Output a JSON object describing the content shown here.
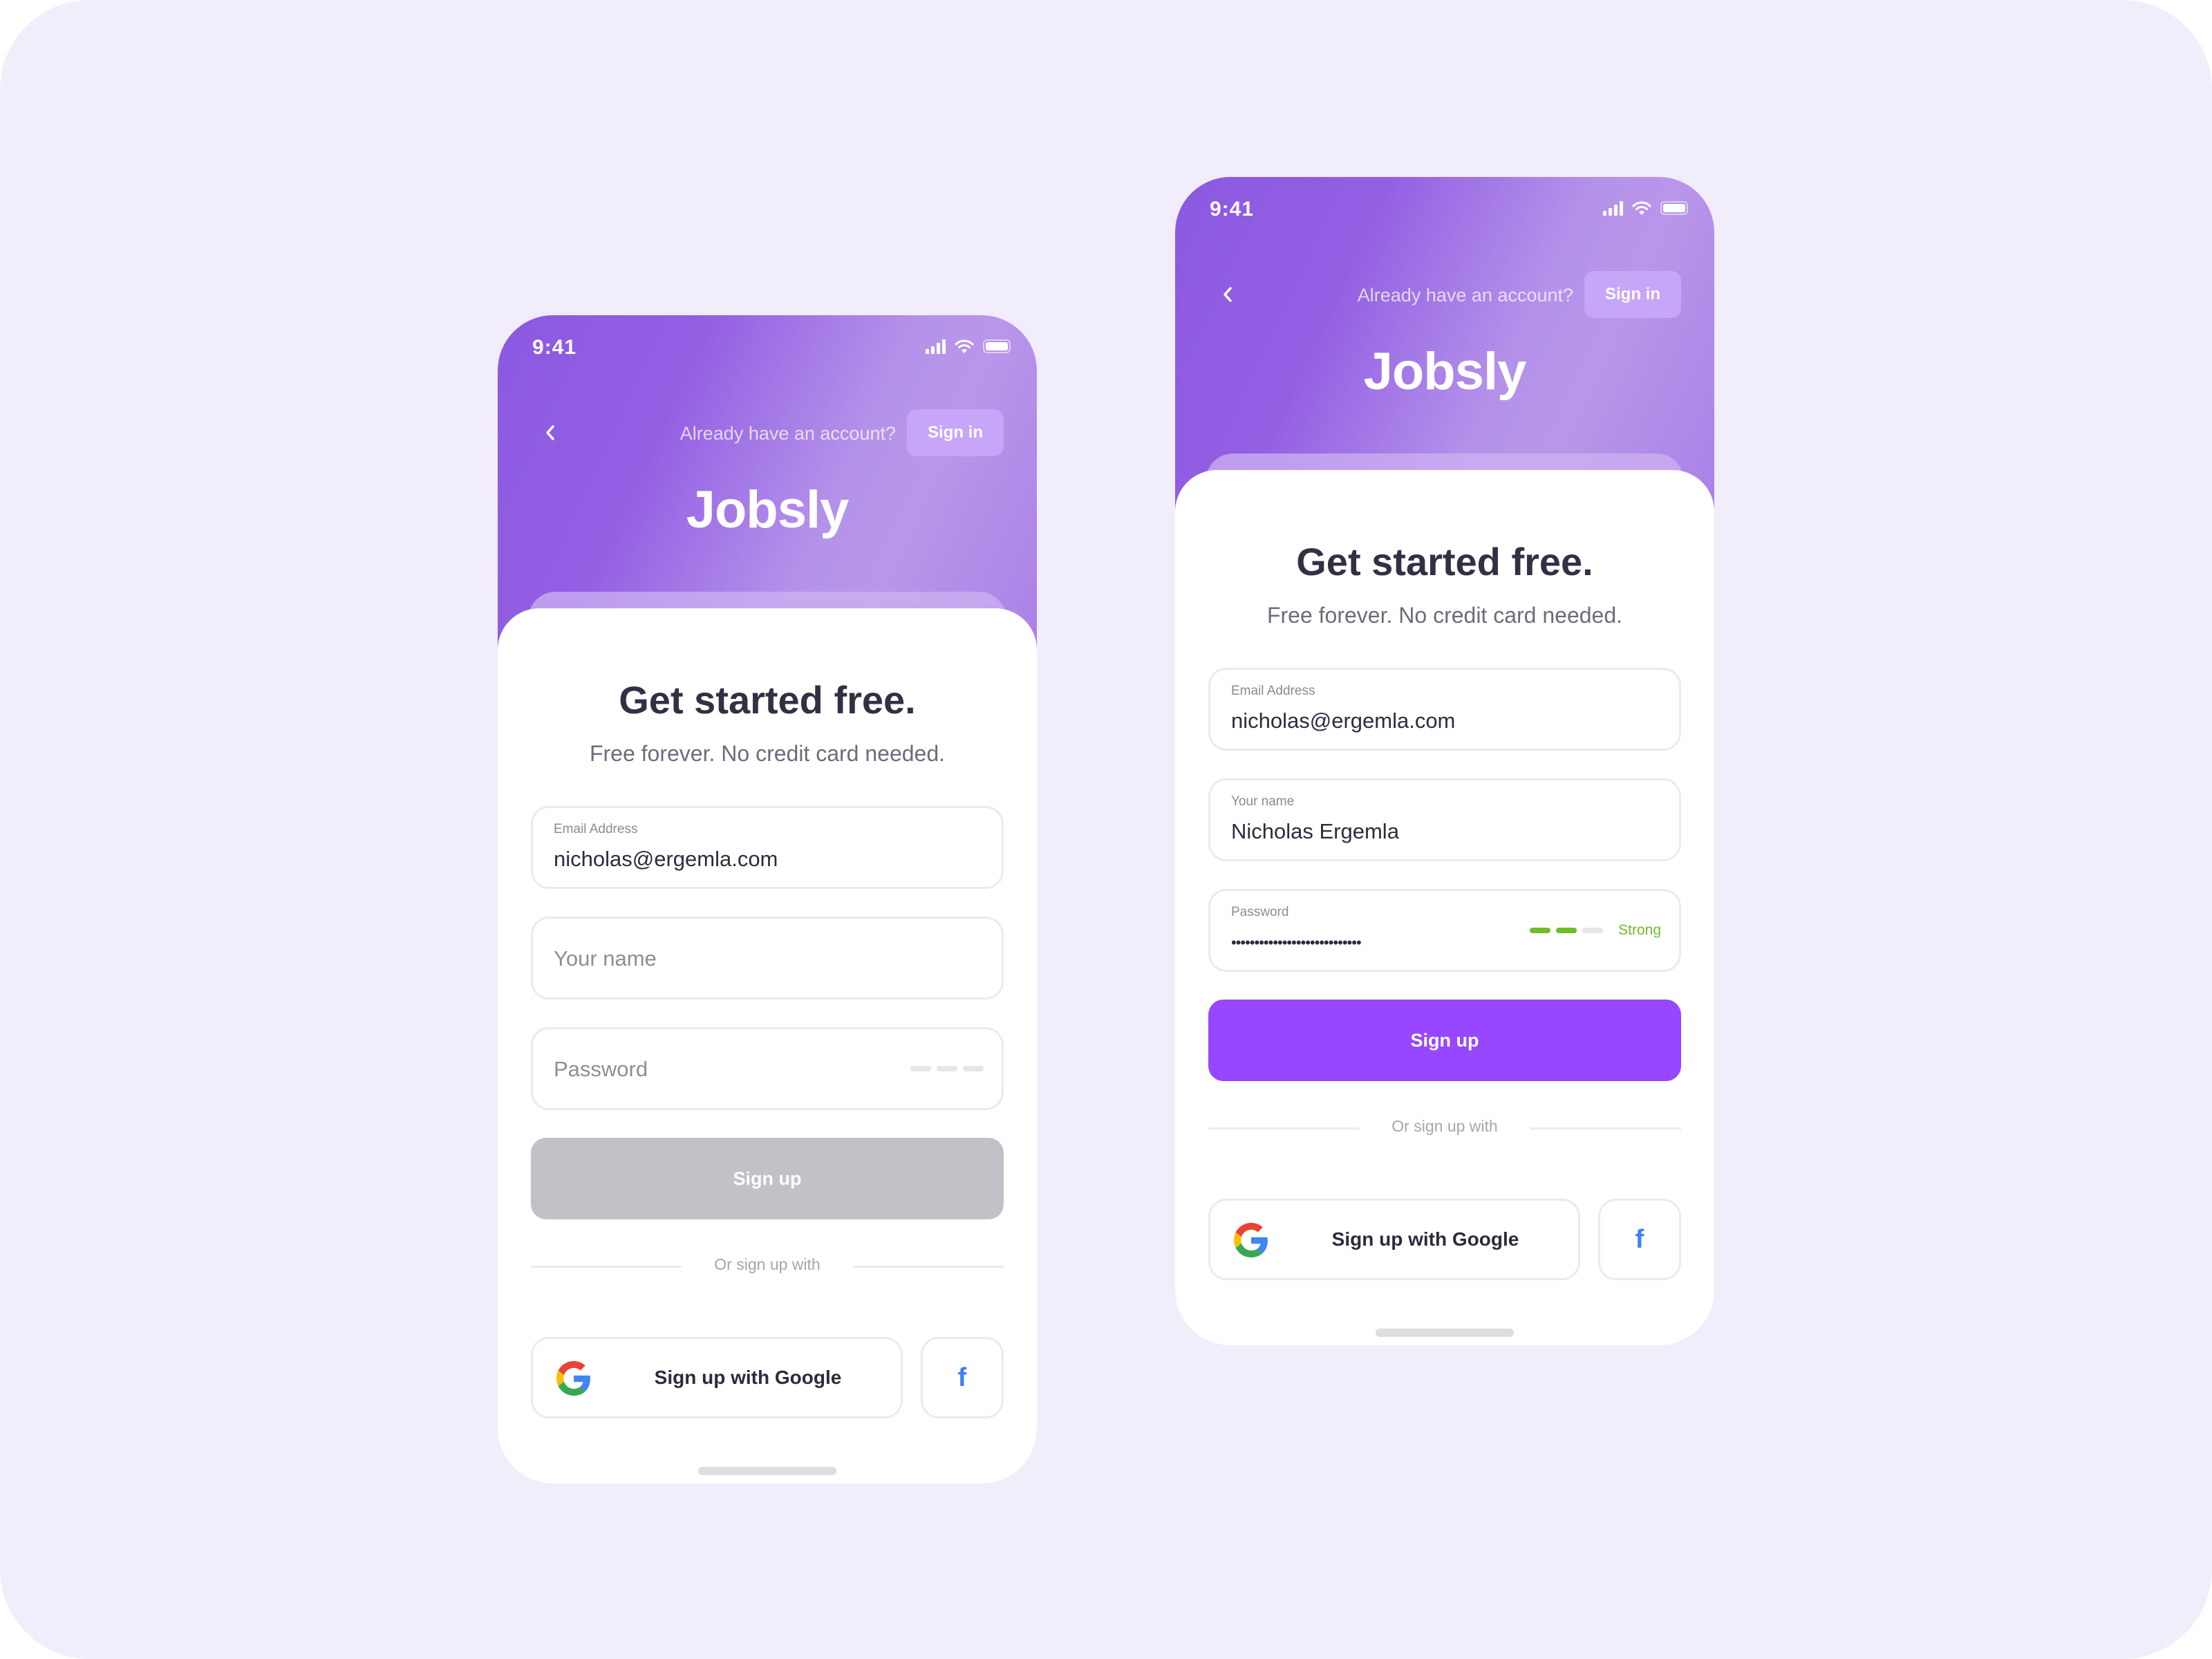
{
  "colors": {
    "background": "#f1edfb",
    "hero_gradient_start": "#8b59e1",
    "hero_gradient_end": "#b996ea",
    "primary": "#9747ff",
    "disabled": "#c3c1c7",
    "strength_green": "#6fbd24",
    "title_text": "#352f44",
    "facebook_blue": "#3b82f0"
  },
  "screens": [
    {
      "state": "empty",
      "status_bar": {
        "time": "9:41",
        "icons": [
          "signal-icon",
          "wifi-icon",
          "battery-icon"
        ]
      },
      "nav": {
        "back_icon": "chevron-left-icon",
        "prompt": "Already have an account?",
        "signin_label": "Sign in"
      },
      "logo": "Jobsly",
      "title": "Get started free.",
      "subtitle": "Free forever. No credit card needed.",
      "fields": {
        "email": {
          "label": "Email Address",
          "value": "nicholas@ergemla.com"
        },
        "name": {
          "placeholder": "Your name",
          "value": ""
        },
        "password": {
          "placeholder": "Password",
          "value": "",
          "strength_level": 0,
          "strength_max": 3,
          "strength_label": ""
        }
      },
      "signup_label": "Sign up",
      "signup_enabled": false,
      "divider_text": "Or sign up with",
      "google_label": "Sign up with Google",
      "google_icon": "google-icon",
      "facebook_icon": "facebook-icon",
      "facebook_glyph": "f"
    },
    {
      "state": "filled",
      "status_bar": {
        "time": "9:41",
        "icons": [
          "signal-icon",
          "wifi-icon",
          "battery-icon"
        ]
      },
      "nav": {
        "back_icon": "chevron-left-icon",
        "prompt": "Already have an account?",
        "signin_label": "Sign in"
      },
      "logo": "Jobsly",
      "title": "Get started free.",
      "subtitle": "Free forever. No credit card needed.",
      "fields": {
        "email": {
          "label": "Email Address",
          "value": "nicholas@ergemla.com"
        },
        "name": {
          "label": "Your name",
          "value": "Nicholas Ergemla"
        },
        "password": {
          "label": "Password",
          "masked_value": "••••••••••••••••••••••••••••",
          "strength_level": 2,
          "strength_max": 3,
          "strength_label": "Strong"
        }
      },
      "signup_label": "Sign up",
      "signup_enabled": true,
      "divider_text": "Or sign up with",
      "google_label": "Sign up with Google",
      "google_icon": "google-icon",
      "facebook_icon": "facebook-icon",
      "facebook_glyph": "f"
    }
  ]
}
